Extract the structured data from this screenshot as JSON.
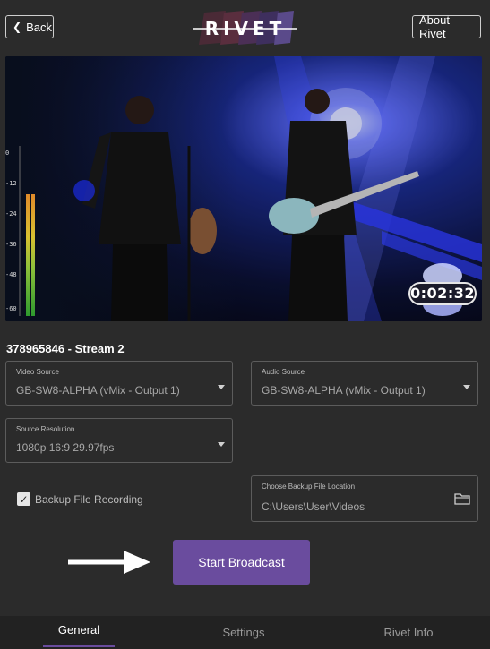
{
  "header": {
    "back_label": "Back",
    "about_label": "About Rivet",
    "logo_text": "RIVET"
  },
  "preview": {
    "timer": "0:02:32",
    "meter_labels": [
      "0",
      "-12",
      "-24",
      "-36",
      "-48",
      "-60"
    ]
  },
  "stream": {
    "title": "378965846 - Stream 2"
  },
  "fields": {
    "video_source": {
      "label": "Video Source",
      "value": "GB-SW8-ALPHA (vMix - Output 1)"
    },
    "audio_source": {
      "label": "Audio Source",
      "value": "GB-SW8-ALPHA (vMix - Output 1)"
    },
    "source_resolution": {
      "label": "Source Resolution",
      "value": "1080p 16:9 29.97fps"
    },
    "backup_location": {
      "label": "Choose Backup File Location",
      "value": "C:\\Users\\User\\Videos"
    }
  },
  "backup_recording": {
    "label": "Backup File Recording",
    "checked": true
  },
  "actions": {
    "start_label": "Start Broadcast"
  },
  "tabs": [
    {
      "label": "General",
      "active": true
    },
    {
      "label": "Settings",
      "active": false
    },
    {
      "label": "Rivet Info",
      "active": false
    }
  ],
  "colors": {
    "background": "#2b2b2b",
    "accent": "#6a4c9e",
    "tabbar": "#222222"
  }
}
